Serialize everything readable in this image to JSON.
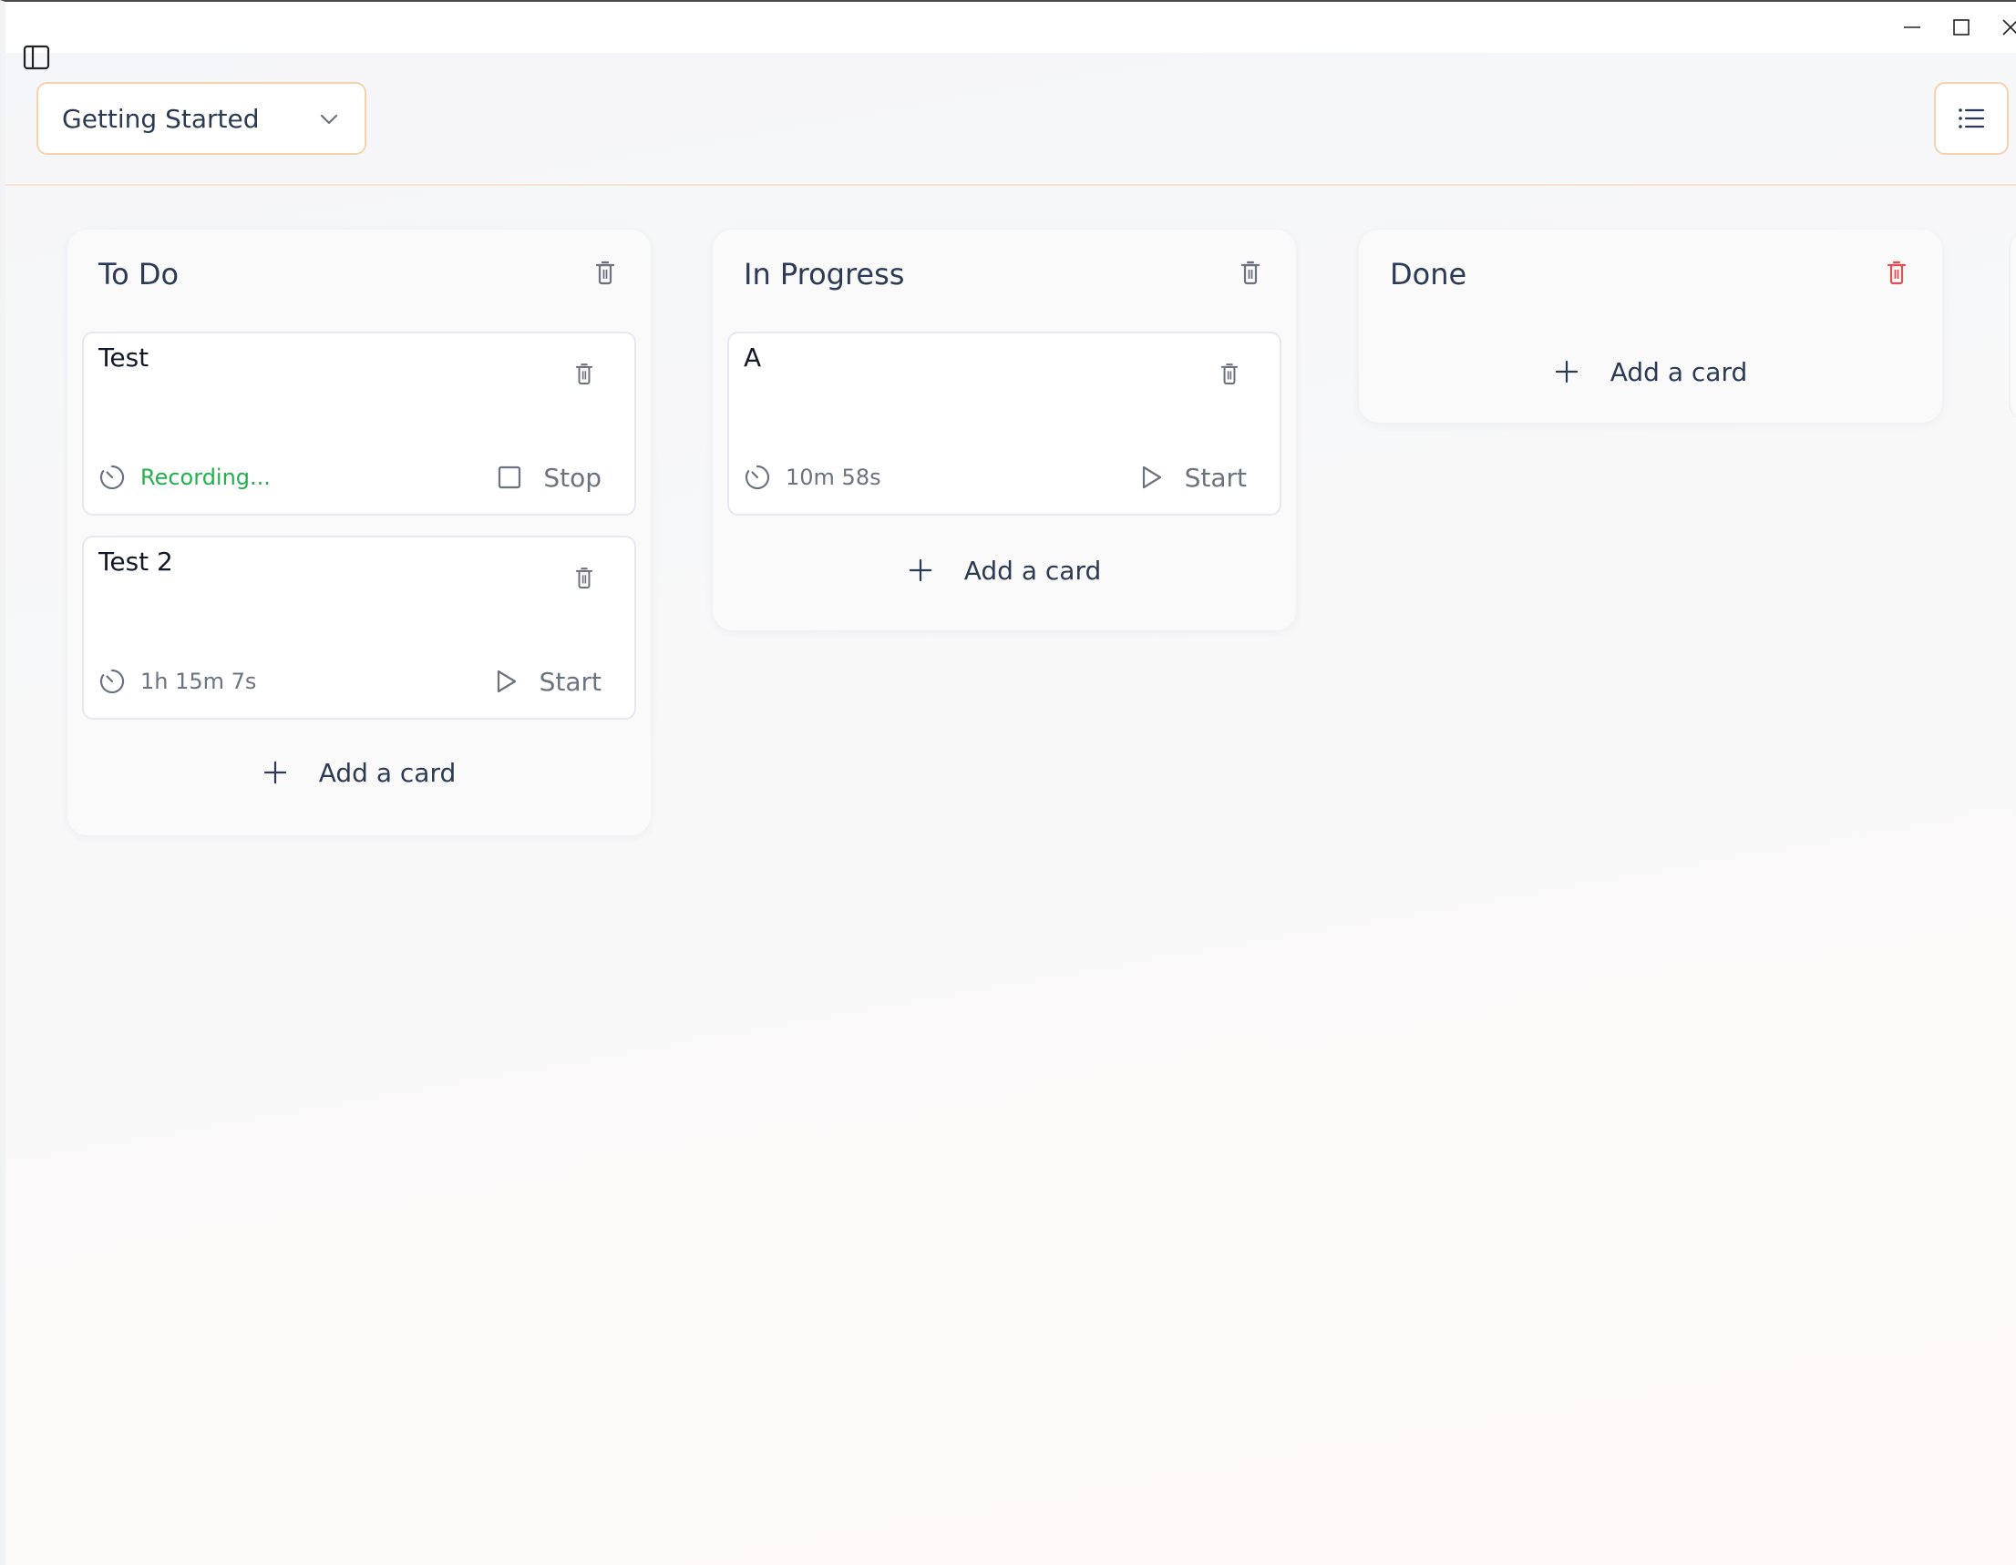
{
  "window": {
    "controls": {
      "minimize": "minimize",
      "maximize": "maximize",
      "close": "close"
    }
  },
  "toolbar": {
    "board_select": {
      "selected": "Getting Started",
      "icon": "chevron-down-icon"
    },
    "menu_icon": "list-icon",
    "sidebar_icon": "sidebar-toggle-icon"
  },
  "columns": [
    {
      "title": "To Do",
      "cards": [
        {
          "title": "Test",
          "time": "Recording...",
          "recording": true,
          "action": "Stop"
        },
        {
          "title": "Test 2",
          "time": "1h 15m 7s",
          "recording": false,
          "action": "Start"
        }
      ],
      "add_label": "Add a card"
    },
    {
      "title": "In Progress",
      "cards": [
        {
          "title": "A",
          "time": "10m 58s",
          "recording": false,
          "action": "Start"
        }
      ],
      "add_label": "Add a card"
    },
    {
      "title": "Done",
      "cards": [],
      "add_label": "Add a card",
      "delete_color": "#e05252"
    }
  ],
  "colors": {
    "accent_border": "#f3d3ae",
    "recording": "#22b14c",
    "heading": "#2b3a55",
    "muted": "#6b7280",
    "danger": "#e05252"
  }
}
